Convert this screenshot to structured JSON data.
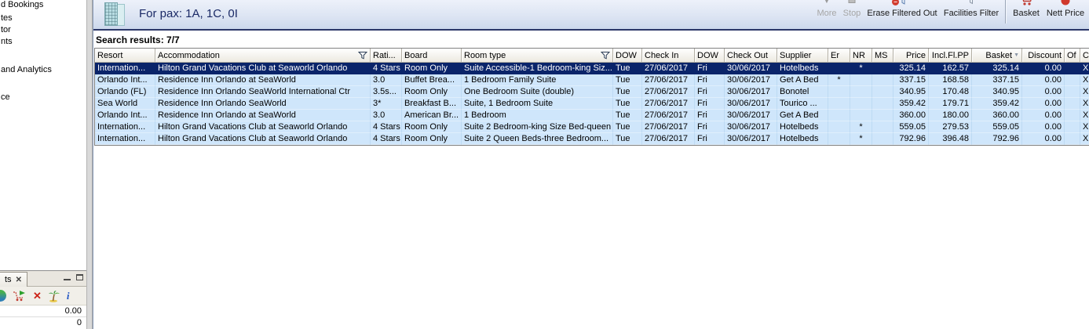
{
  "sidebar": {
    "items": [
      "d Bookings",
      "tes",
      "tor",
      "nts",
      "and Analytics",
      "ce"
    ]
  },
  "topbar": {
    "pax_label": "For pax: 1A, 1C, 0I",
    "buttons": {
      "more": "More",
      "stop": "Stop",
      "erase_filtered_out": "Erase Filtered Out",
      "facilities_filter": "Facilities Filter",
      "basket": "Basket",
      "nett_price": "Nett Price"
    }
  },
  "results_label": "Search results: 7/7",
  "table": {
    "headers": {
      "resort": "Resort",
      "accommodation": "Accommodation",
      "rating": "Rati...",
      "board": "Board",
      "room_type": "Room type",
      "dow_in": "DOW",
      "check_in": "Check In",
      "dow_out": "DOW",
      "check_out": "Check Out",
      "supplier": "Supplier",
      "er": "Er",
      "nr": "NR",
      "ms": "MS",
      "price": "Price",
      "incl_fl_pp": "Incl.Fl.PP",
      "basket": "Basket",
      "discount": "Discount",
      "of": "Of",
      "c": "C"
    },
    "rows": [
      {
        "resort": "Internation...",
        "accommodation": "Hilton Grand Vacations Club at Seaworld Orlando",
        "rating": "4 Stars",
        "board": "Room Only",
        "room_type": "Suite Accessible-1 Bedroom-king Siz...",
        "dow_in": "Tue",
        "check_in": "27/06/2017",
        "dow_out": "Fri",
        "check_out": "30/06/2017",
        "supplier": "Hotelbeds",
        "er": "",
        "nr": "*",
        "ms": "",
        "price": "325.14",
        "incl_fl_pp": "162.57",
        "basket": "325.14",
        "discount": "0.00",
        "of": "",
        "c": "XI"
      },
      {
        "resort": "Orlando Int...",
        "accommodation": "Residence Inn Orlando at SeaWorld",
        "rating": "3.0",
        "board": "Buffet Brea...",
        "room_type": "1 Bedroom Family Suite",
        "dow_in": "Tue",
        "check_in": "27/06/2017",
        "dow_out": "Fri",
        "check_out": "30/06/2017",
        "supplier": "Get A Bed",
        "er": "*",
        "nr": "",
        "ms": "",
        "price": "337.15",
        "incl_fl_pp": "168.58",
        "basket": "337.15",
        "discount": "0.00",
        "of": "",
        "c": "XI"
      },
      {
        "resort": "Orlando (FL)",
        "accommodation": "Residence Inn Orlando SeaWorld International Ctr",
        "rating": "3.5s...",
        "board": "Room Only",
        "room_type": "One Bedroom Suite (double)",
        "dow_in": "Tue",
        "check_in": "27/06/2017",
        "dow_out": "Fri",
        "check_out": "30/06/2017",
        "supplier": "Bonotel",
        "er": "",
        "nr": "",
        "ms": "",
        "price": "340.95",
        "incl_fl_pp": "170.48",
        "basket": "340.95",
        "discount": "0.00",
        "of": "",
        "c": "XI"
      },
      {
        "resort": "Sea World",
        "accommodation": "Residence Inn Orlando SeaWorld",
        "rating": "3*",
        "board": "Breakfast B...",
        "room_type": "Suite, 1 Bedroom Suite",
        "dow_in": "Tue",
        "check_in": "27/06/2017",
        "dow_out": "Fri",
        "check_out": "30/06/2017",
        "supplier": "Tourico ...",
        "er": "",
        "nr": "",
        "ms": "",
        "price": "359.42",
        "incl_fl_pp": "179.71",
        "basket": "359.42",
        "discount": "0.00",
        "of": "",
        "c": "XI"
      },
      {
        "resort": "Orlando Int...",
        "accommodation": "Residence Inn Orlando at SeaWorld",
        "rating": "3.0",
        "board": "American Br...",
        "room_type": "1 Bedroom",
        "dow_in": "Tue",
        "check_in": "27/06/2017",
        "dow_out": "Fri",
        "check_out": "30/06/2017",
        "supplier": "Get A Bed",
        "er": "",
        "nr": "",
        "ms": "",
        "price": "360.00",
        "incl_fl_pp": "180.00",
        "basket": "360.00",
        "discount": "0.00",
        "of": "",
        "c": "XI"
      },
      {
        "resort": "Internation...",
        "accommodation": "Hilton Grand Vacations Club at Seaworld Orlando",
        "rating": "4 Stars",
        "board": "Room Only",
        "room_type": "Suite 2 Bedroom-king Size Bed-queen",
        "dow_in": "Tue",
        "check_in": "27/06/2017",
        "dow_out": "Fri",
        "check_out": "30/06/2017",
        "supplier": "Hotelbeds",
        "er": "",
        "nr": "*",
        "ms": "",
        "price": "559.05",
        "incl_fl_pp": "279.53",
        "basket": "559.05",
        "discount": "0.00",
        "of": "",
        "c": "XI"
      },
      {
        "resort": "Internation...",
        "accommodation": "Hilton Grand Vacations Club at Seaworld Orlando",
        "rating": "4 Stars",
        "board": "Room Only",
        "room_type": "Suite 2 Queen Beds-three Bedroom...",
        "dow_in": "Tue",
        "check_in": "27/06/2017",
        "dow_out": "Fri",
        "check_out": "30/06/2017",
        "supplier": "Hotelbeds",
        "er": "",
        "nr": "*",
        "ms": "",
        "price": "792.96",
        "incl_fl_pp": "396.48",
        "basket": "792.96",
        "discount": "0.00",
        "of": "",
        "c": "XI"
      }
    ]
  },
  "bottom_panel": {
    "tab_label": "ts",
    "total": "0.00",
    "count": "0"
  },
  "colors": {
    "selected_row": "#0a246a",
    "row_background": "#cfe6fb",
    "header_rule": "#2b3768",
    "toolbar_red": "#c03a30"
  }
}
